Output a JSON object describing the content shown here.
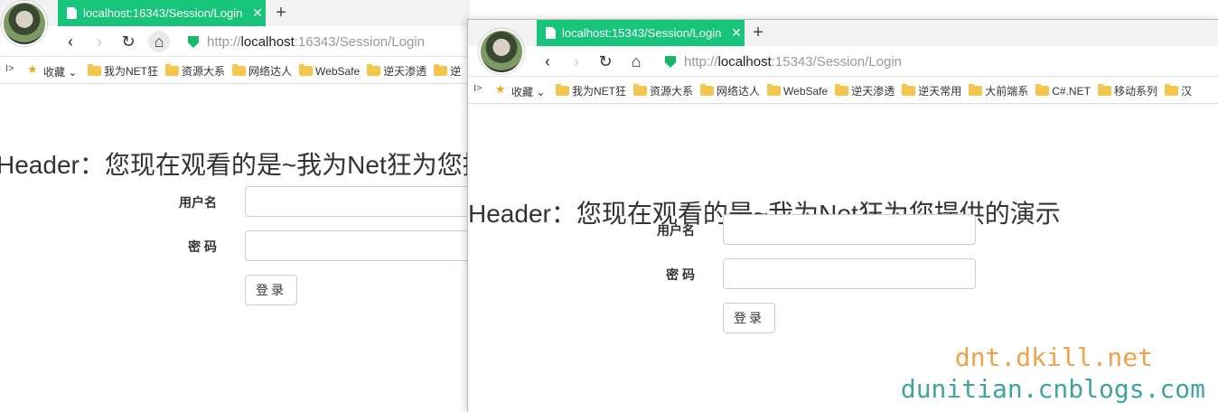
{
  "window1": {
    "tab_title": "localhost:16343/Session/Login",
    "tab_close": "✕",
    "new_tab": "+",
    "url_scheme": "http://",
    "url_host": "localhost",
    "url_rest": ":16343/Session/Login",
    "header_text": "Header：您现在观看的是~我为Net狂为您提供的演示",
    "username_label": "用户名",
    "password_label": "密 码",
    "login_label": "登录"
  },
  "window2": {
    "tab_title": "localhost:15343/Session/Login",
    "tab_close": "✕",
    "new_tab": "+",
    "url_scheme": "http://",
    "url_host": "localhost",
    "url_rest": ":15343/Session/Login",
    "header_text": "Header：您现在观看的是~我为Net狂为您提供的演示",
    "username_label": "用户名",
    "password_label": "密 码",
    "login_label": "登录"
  },
  "nav": {
    "back": "‹",
    "forward": "›",
    "reload": "↻",
    "home": "⌂"
  },
  "bookmarks": {
    "toggle": "I>",
    "favorites_label": "收藏",
    "favorites_chevron": "⌄",
    "items1": [
      "我为NET狂",
      "资源大系",
      "网络达人",
      "WebSafe",
      "逆天渗透",
      "逆"
    ],
    "items2": [
      "我为NET狂",
      "资源大系",
      "网络达人",
      "WebSafe",
      "逆天渗透",
      "逆天常用",
      "大前端系",
      "C#.NET",
      "移动系列",
      "汉"
    ]
  },
  "watermark": {
    "line1": "dnt.dkill.net",
    "line2": "dunitian.cnblogs.com"
  },
  "colors": {
    "tab_active": "#16c47a",
    "secure_shield": "#1ab66a",
    "watermark1": "#f0a24a",
    "watermark2": "#3fa4a0"
  }
}
